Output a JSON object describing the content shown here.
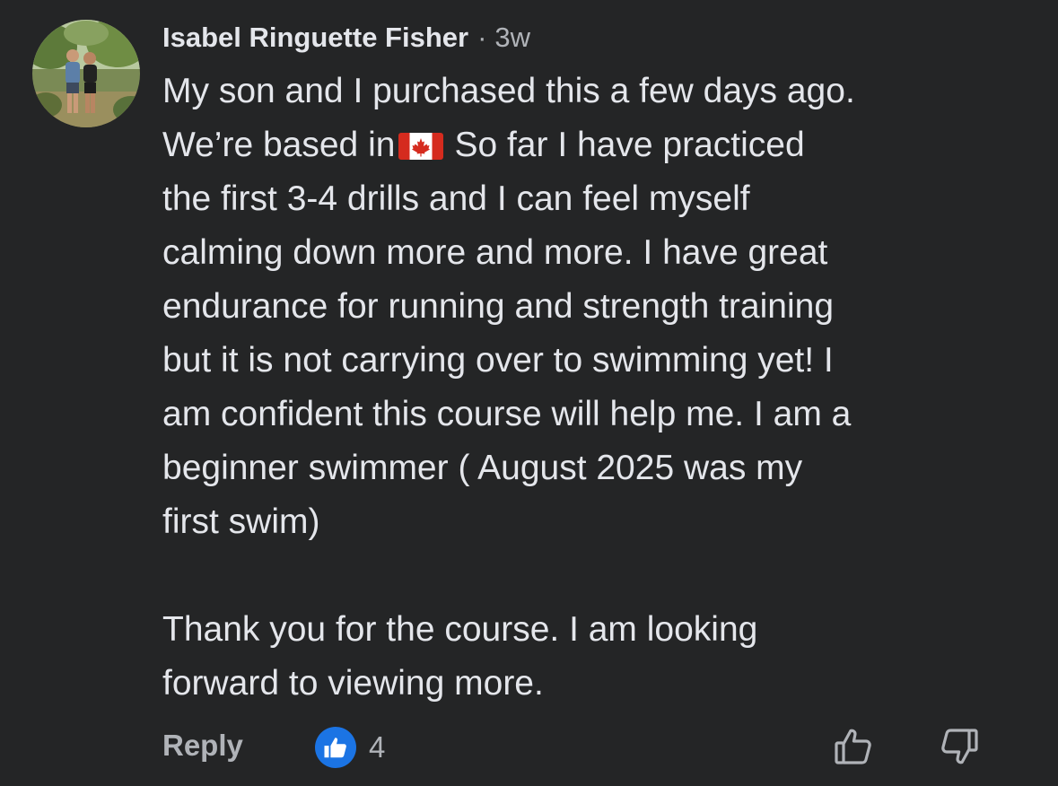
{
  "comment": {
    "author": "Isabel Ringuette Fisher",
    "separator": "·",
    "time": "3w",
    "avatar_icon": "profile-photo",
    "lines": [
      "My son and I purchased this a few days ago.",
      "We’re based in",
      "So far I have practiced",
      "the first 3-4 drills and I can feel myself",
      "calming down more and more.  I have great",
      "endurance for running and strength training",
      "but it is not carrying over to swimming yet! I",
      "am confident this course will help me.  I am a",
      "beginner swimmer ( August 2025 was my",
      "first swim)",
      "Thank you for the course. I am looking",
      "forward to viewing more."
    ],
    "flag_icon": "canada-flag-icon"
  },
  "actions": {
    "reply_label": "Reply",
    "like_count": "4",
    "like_badge_icon": "thumbs-up-badge-icon",
    "like_icon": "thumbs-up-icon",
    "dislike_icon": "thumbs-down-icon"
  },
  "colors": {
    "background": "#242526",
    "text": "#e4e6eb",
    "secondary_text": "#b0b3b8",
    "like_blue": "#1b74e4",
    "flag_red": "#d52b1e"
  }
}
